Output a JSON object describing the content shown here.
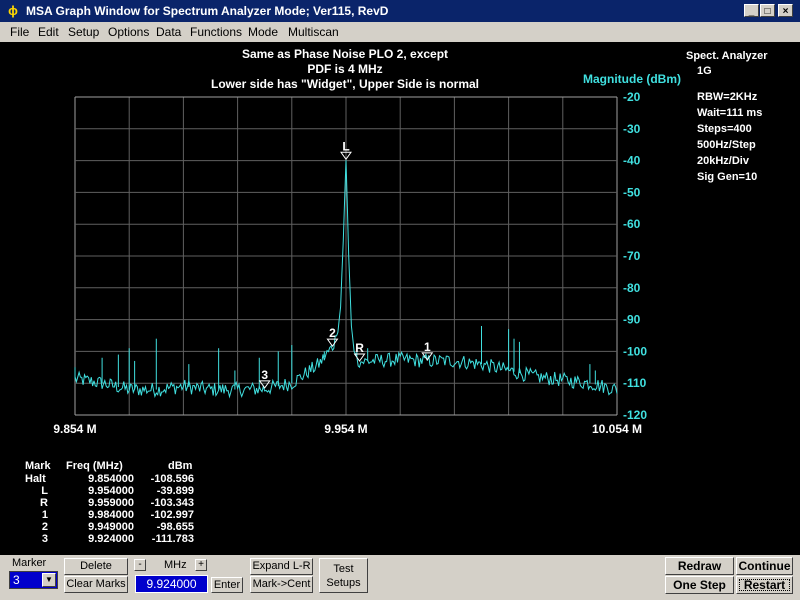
{
  "window": {
    "title": "MSA Graph Window for Spectrum Analyzer Mode; Ver115, RevD"
  },
  "menu": [
    "File",
    "Edit",
    "Setup",
    "Options",
    "Data",
    "Functions",
    "Mode",
    "Multiscan"
  ],
  "graph": {
    "title_lines": [
      "Same as Phase Noise PLO 2, except",
      "PDF is 4 MHz",
      "Lower side has \"Widget\", Upper Side is normal"
    ],
    "mode_label": "Spect. Analyzer",
    "mode_sub": "1G",
    "settings": [
      "RBW=2KHz",
      "Wait=111 ms",
      "Steps=400",
      "500Hz/Step",
      "20kHz/Div",
      "Sig Gen=10"
    ],
    "trace_color": "#40e0e0"
  },
  "chart_data": {
    "type": "line",
    "ylabel": "Magnitude (dBm)",
    "ylim": [
      -120,
      -20
    ],
    "yticks": [
      "-20",
      "-30",
      "-40",
      "-50",
      "-60",
      "-70",
      "-80",
      "-90",
      "-100",
      "-110",
      "-120"
    ],
    "xlim": [
      9.854,
      10.054
    ],
    "xticks": [
      "9.854 M",
      "9.954 M",
      "10.054 M"
    ],
    "grid": true,
    "series": [
      {
        "x": [
          9.854,
          9.864,
          9.874,
          9.884,
          9.894,
          9.904,
          9.914,
          9.924,
          9.934,
          9.939,
          9.944,
          9.949,
          9.951,
          9.952,
          9.953,
          9.954,
          9.955,
          9.956,
          9.957,
          9.959,
          9.964,
          9.974,
          9.984,
          9.994,
          10.004,
          10.014,
          10.024,
          10.034,
          10.044,
          10.054
        ],
        "values": [
          -108.6,
          -110,
          -112,
          -112,
          -111,
          -112,
          -112,
          -111.8,
          -110,
          -107,
          -104,
          -98.6,
          -94,
          -86,
          -65,
          -39.9,
          -70,
          -92,
          -100,
          -103.3,
          -103,
          -102.5,
          -103,
          -103,
          -104,
          -106,
          -108,
          -109,
          -110,
          -112
        ]
      }
    ],
    "spurs": [
      {
        "x": 9.854,
        "y": -105
      },
      {
        "x": 9.864,
        "y": -102
      },
      {
        "x": 9.87,
        "y": -101
      },
      {
        "x": 9.874,
        "y": -99
      },
      {
        "x": 9.876,
        "y": -103
      },
      {
        "x": 9.884,
        "y": -96
      },
      {
        "x": 9.896,
        "y": -104
      },
      {
        "x": 9.907,
        "y": -99
      },
      {
        "x": 9.913,
        "y": -106
      },
      {
        "x": 9.922,
        "y": -102
      },
      {
        "x": 9.929,
        "y": -100
      },
      {
        "x": 9.934,
        "y": -98
      },
      {
        "x": 9.946,
        "y": -100
      },
      {
        "x": 9.958,
        "y": -100
      },
      {
        "x": 9.962,
        "y": -99
      },
      {
        "x": 10.004,
        "y": -92
      },
      {
        "x": 10.014,
        "y": -93
      },
      {
        "x": 10.016,
        "y": -96
      },
      {
        "x": 10.018,
        "y": -97
      },
      {
        "x": 10.044,
        "y": -104
      },
      {
        "x": 10.046,
        "y": -106
      }
    ],
    "markers": [
      {
        "label": "L",
        "x": 9.954,
        "y": -39.9
      },
      {
        "label": "2",
        "x": 9.949,
        "y": -98.655
      },
      {
        "label": "R",
        "x": 9.959,
        "y": -103.343
      },
      {
        "label": "1",
        "x": 9.984,
        "y": -102.997
      },
      {
        "label": "3",
        "x": 9.924,
        "y": -111.783
      }
    ]
  },
  "marker_table": {
    "headers": [
      "Mark",
      "Freq (MHz)",
      "dBm"
    ],
    "rows": [
      [
        "Halt",
        "9.854000",
        "-108.596"
      ],
      [
        "L",
        "9.954000",
        "-39.899"
      ],
      [
        "R",
        "9.959000",
        "-103.343"
      ],
      [
        "1",
        "9.984000",
        "-102.997"
      ],
      [
        "2",
        "9.949000",
        "-98.655"
      ],
      [
        "3",
        "9.924000",
        "-111.783"
      ]
    ]
  },
  "controls": {
    "marker_label": "Marker",
    "marker_value": "3",
    "delete": "Delete",
    "clear_marks": "Clear Marks",
    "minus": "-",
    "mhz_label": "MHz",
    "plus": "+",
    "freq_value": "9.924000",
    "enter": "Enter",
    "expand": "Expand L-R",
    "mark_cent": "Mark->Cent",
    "test_setups_line1": "Test",
    "test_setups_line2": "Setups",
    "redraw": "Redraw",
    "continue": "Continue",
    "one_step": "One Step",
    "restart": "Restart"
  }
}
